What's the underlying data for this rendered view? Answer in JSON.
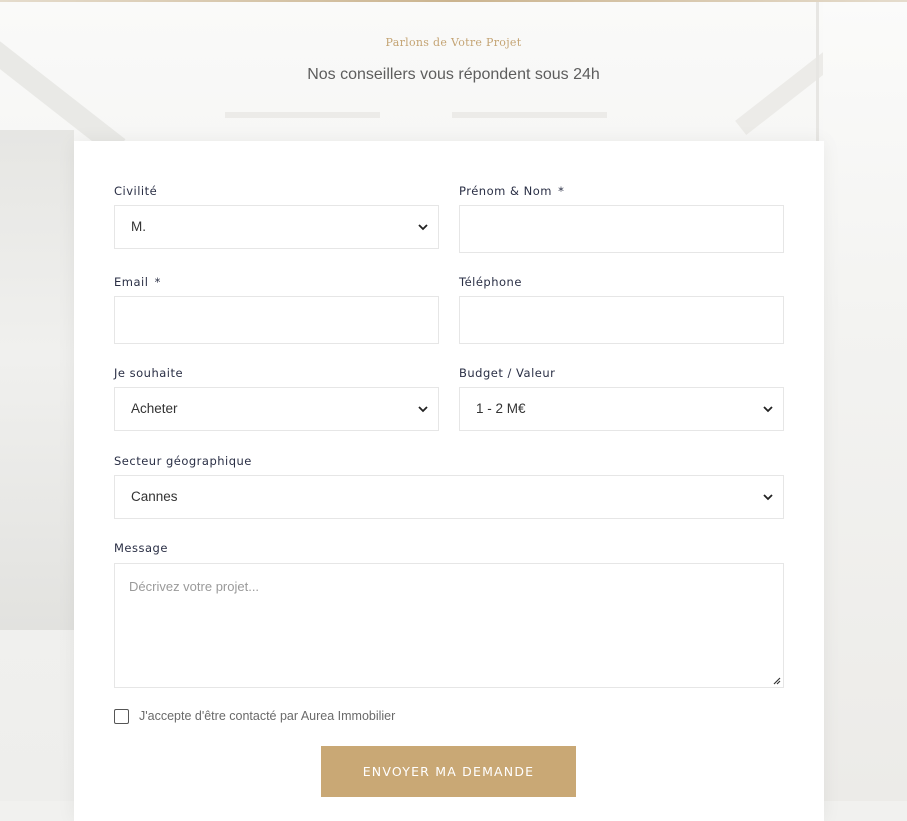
{
  "header": {
    "eyebrow": "Parlons de Votre Projet",
    "subtitle": "Nos conseillers vous répondent sous 24h"
  },
  "form": {
    "civility": {
      "label": "Civilité",
      "value": "M."
    },
    "name": {
      "label": "Prénom & Nom",
      "required_mark": "*",
      "value": ""
    },
    "email": {
      "label": "Email",
      "required_mark": "*",
      "value": ""
    },
    "phone": {
      "label": "Téléphone",
      "value": ""
    },
    "intent": {
      "label": "Je souhaite",
      "value": "Acheter"
    },
    "budget": {
      "label": "Budget / Valeur",
      "value": "1 - 2 M€"
    },
    "sector": {
      "label": "Secteur géographique",
      "value": "Cannes"
    },
    "message": {
      "label": "Message",
      "placeholder": "Décrivez votre projet...",
      "value": ""
    },
    "consent": {
      "label": "J'accepte d'être contacté par Aurea Immobilier",
      "checked": false
    },
    "submit_label": "ENVOYER MA DEMANDE"
  },
  "colors": {
    "accent": "#c9a875",
    "eyebrow": "#c4a474",
    "label": "#2a2f45"
  },
  "icons": {
    "select_arrow": "chevron-down-icon",
    "resize": "resize-grip-icon"
  }
}
